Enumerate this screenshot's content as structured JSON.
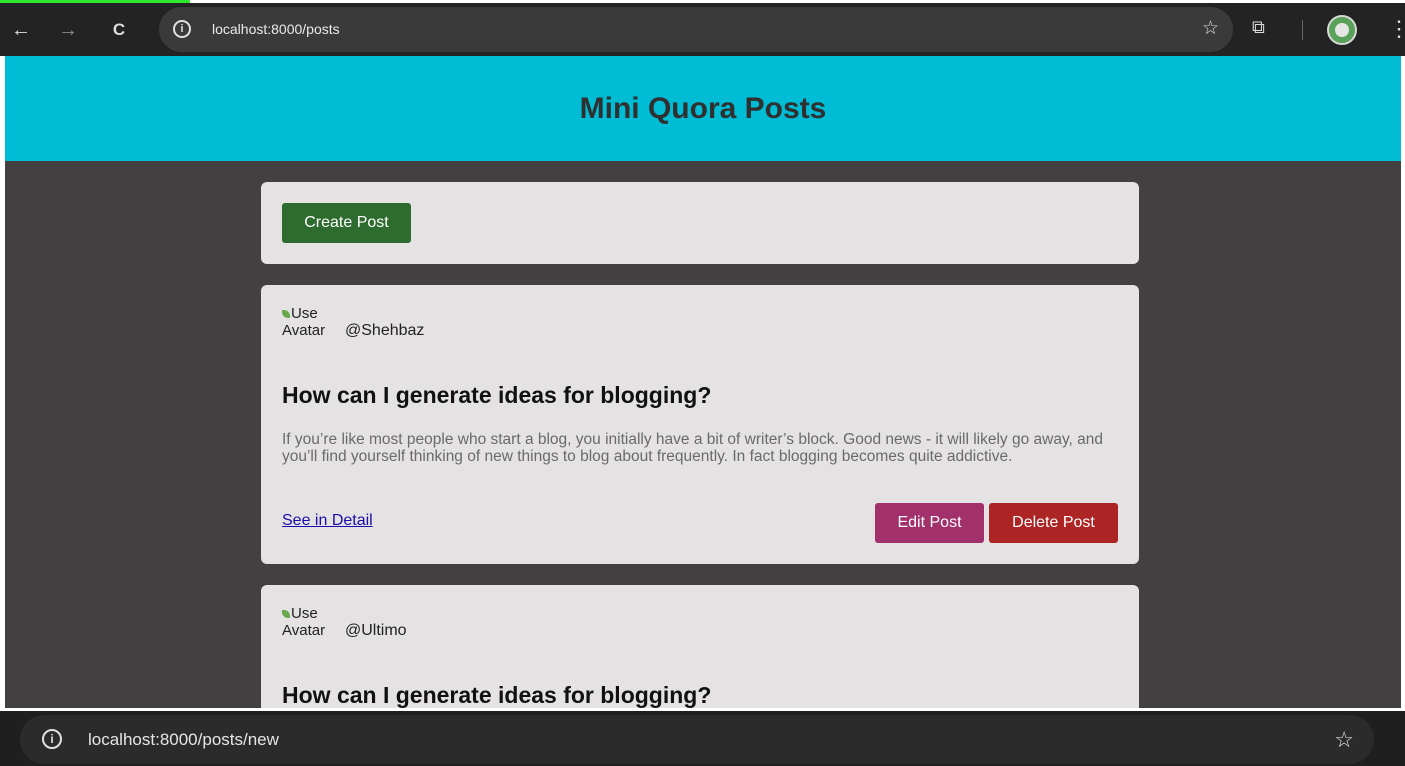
{
  "browser": {
    "url": "localhost:8000/posts",
    "back_icon": "←",
    "forward_icon": "→",
    "reload_icon": "C",
    "info_icon": "i",
    "star_icon": "☆",
    "extensions_icon": "⧉",
    "menu_icon": "⋮"
  },
  "header": {
    "title": "Mini Quora Posts"
  },
  "create_button": "Create Post",
  "posts": [
    {
      "avatar_alt_line1": "Use",
      "avatar_alt_line2": "Avatar",
      "username": "@Shehbaz",
      "title": "How can I generate ideas for blogging?",
      "body": "If you’re like most people who start a blog, you initially have a bit of writer’s block. Good news - it will likely go away, and you’ll find yourself thinking of new things to blog about frequently. In fact blogging becomes quite addictive.",
      "detail_link": "See in Detail",
      "edit_button": "Edit Post",
      "delete_button": "Delete Post"
    },
    {
      "avatar_alt_line1": "Use",
      "avatar_alt_line2": "Avatar",
      "username": "@Ultimo",
      "title": "How can I generate ideas for blogging?"
    }
  ],
  "bottom_browser": {
    "url": "localhost:8000/posts/new",
    "info_icon": "i",
    "star_icon": "☆"
  },
  "colors": {
    "header_bg": "#00bcd4",
    "page_bg": "#424041",
    "card_bg": "#e4e2e3",
    "create_button": "#2e6b2e",
    "edit_button": "#a2306a",
    "delete_button": "#ac2424"
  }
}
